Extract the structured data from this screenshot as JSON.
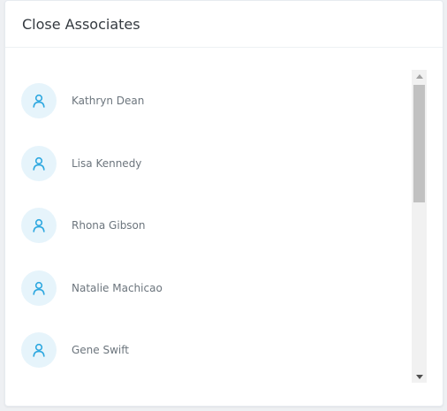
{
  "panel": {
    "title": "Close Associates"
  },
  "associates": [
    {
      "name": "Kathryn Dean",
      "icon": "user-icon"
    },
    {
      "name": "Lisa Kennedy",
      "icon": "user-icon"
    },
    {
      "name": "Rhona Gibson",
      "icon": "user-icon"
    },
    {
      "name": "Natalie Machicao",
      "icon": "user-icon"
    },
    {
      "name": "Gene Swift",
      "icon": "user-icon"
    }
  ],
  "colors": {
    "avatar_bg": "#e6f4fb",
    "icon": "#2ea8e0",
    "name_text": "#6c757d",
    "title_text": "#343a40"
  }
}
